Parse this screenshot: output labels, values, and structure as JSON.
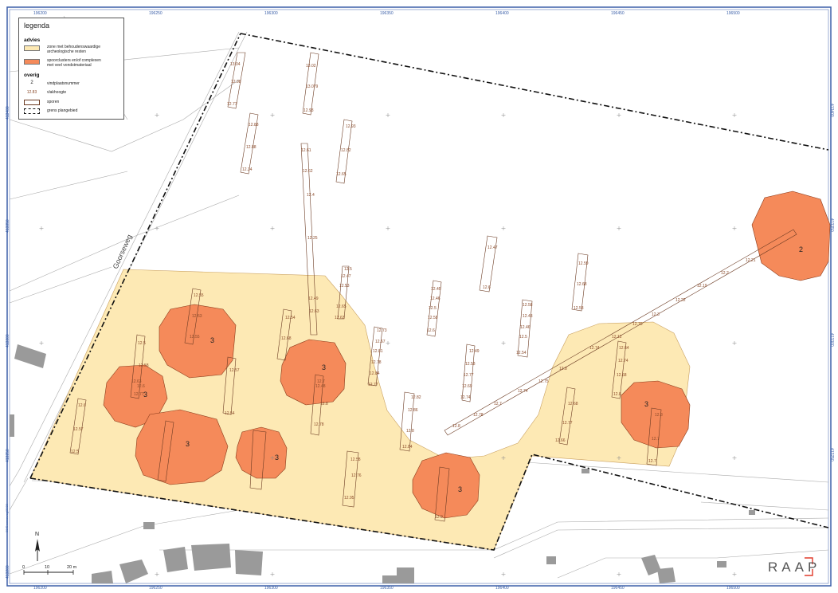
{
  "legend": {
    "title": "legenda",
    "advies_heading": "advies",
    "advies_items": [
      {
        "label_line1": "zone met behoudenswaardige",
        "label_line2": "archeologische resten",
        "color": "#fde9b4"
      },
      {
        "label_line1": "spoorclusters en/of complexen",
        "label_line2": "met veel vondstmateriaal",
        "color": "#f58a5a"
      }
    ],
    "overig_heading": "overig",
    "overig_items": [
      {
        "symbol": "2",
        "label": "vindplaatsnummer"
      },
      {
        "symbol": "12.83",
        "label": "vlakhoogte"
      },
      {
        "symbol": "",
        "label": "sporen"
      },
      {
        "symbol": "",
        "label": "grens plangebied"
      }
    ]
  },
  "road_name": "Goorseweg",
  "site_numbers": [
    "2",
    "3",
    "3",
    "3",
    "3",
    "3",
    "3",
    "3",
    "3",
    "3"
  ],
  "x_ticks": [
    "196200",
    "196250",
    "196300",
    "196350",
    "196400",
    "196450",
    "196500"
  ],
  "y_ticks": [
    "413400",
    "413350",
    "413300",
    "413250",
    "413200"
  ],
  "scale": {
    "labels": [
      "0",
      "10",
      "20 m"
    ]
  },
  "north_label": "N",
  "brand": "RAAP",
  "side_note": "09/Goorseweg/2020",
  "colors": {
    "zone": "#fde9b4",
    "cluster": "#f58a5a",
    "frame": "#3b5fa8"
  },
  "elevations": [
    "13.04",
    "12.98",
    "12.77",
    "13.02",
    "13.079",
    "12.93",
    "12.88",
    "12.88",
    "12.34",
    "12.93",
    "12.82",
    "12.65",
    "12.61",
    "12.62",
    "12.4",
    "12.25",
    "12.5",
    "12.47",
    "12.53",
    "12.65",
    "12.63",
    "12.49",
    "12.63",
    "12.47",
    "12.6",
    "12.45",
    "12.46",
    "12.5",
    "12.58",
    "12.6",
    "12.58",
    "12.43",
    "12.46",
    "12.5",
    "12.54",
    "12.59",
    "12.68",
    "12.58",
    "12.54",
    "12.68",
    "12.73",
    "12.67",
    "12.81",
    "12.78",
    "12.84",
    "12.77",
    "12.5",
    "12.58",
    "12.6",
    "12.63",
    "12.77",
    "12.6",
    "12.57",
    "12.5",
    "12.55",
    "12.63",
    "12.55",
    "12.57",
    "12.54",
    "12.82",
    "12.86",
    "12.8",
    "12.84",
    "12.49",
    "12.58",
    "12.77",
    "12.69",
    "12.74",
    "12.48",
    "12.8",
    "12.78",
    "12.7",
    "12.21",
    "12.2",
    "12.19",
    "12.22",
    "12.3",
    "12.15",
    "12.12",
    "12.74",
    "12.8",
    "12.75",
    "12.74",
    "12.7",
    "12.78",
    "12.8",
    "12.68",
    "12.77",
    "12.66",
    "12.64",
    "12.74",
    "12.68",
    "12.8",
    "12.8",
    "12.7",
    "12.7",
    "12.58",
    "12.76",
    "12.95",
    "12.9"
  ]
}
